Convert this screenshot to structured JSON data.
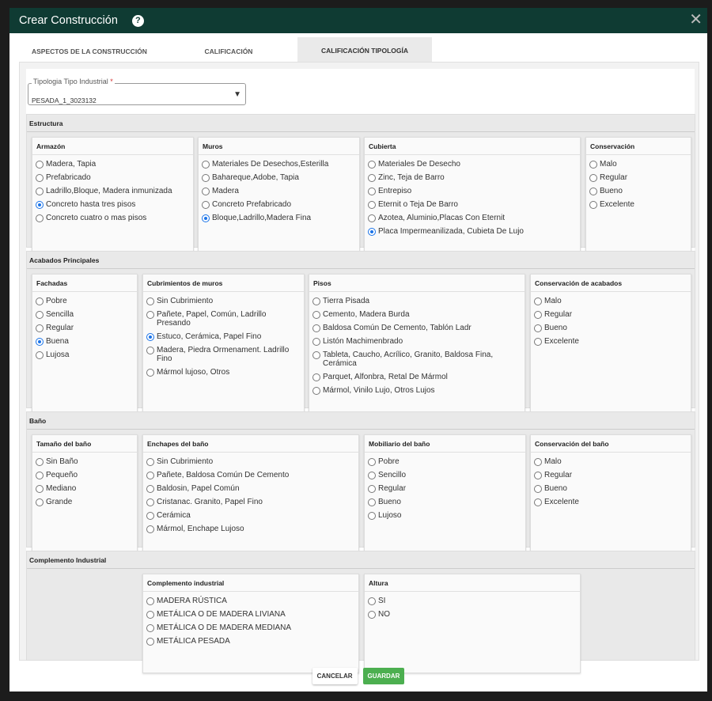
{
  "modal": {
    "title": "Crear Construcción",
    "close": "✕",
    "help": "?"
  },
  "tabs": [
    "ASPECTOS DE LA CONSTRUCCIÓN",
    "CALIFICACIÓN",
    "CALIFICACIÓN TIPOLOGÍA"
  ],
  "tipologia": {
    "label": "Tipologia Tipo Industrial",
    "required": "*",
    "value": "PESADA_1_3023132"
  },
  "sections": {
    "estructura": {
      "title": "Estructura",
      "groups": [
        {
          "title": "Armazón",
          "options": [
            "Madera, Tapia",
            "Prefabricado",
            "Ladrillo,Bloque, Madera inmunizada",
            "Concreto hasta tres pisos",
            "Concreto cuatro o mas pisos"
          ],
          "selected": 3
        },
        {
          "title": "Muros",
          "options": [
            "Materiales De Desechos,Esterilla",
            "Bahareque,Adobe, Tapia",
            "Madera",
            "Concreto Prefabricado",
            "Bloque,Ladrillo,Madera Fina"
          ],
          "selected": 4
        },
        {
          "title": "Cubierta",
          "options": [
            "Materiales De Desecho",
            "Zinc, Teja de Barro",
            "Entrepiso",
            "Eternit o Teja De Barro",
            "Azotea, Aluminio,Placas Con Eternit",
            "Placa Impermeanilizada, Cubieta De Lujo"
          ],
          "selected": 5
        },
        {
          "title": "Conservación",
          "options": [
            "Malo",
            "Regular",
            "Bueno",
            "Excelente"
          ],
          "selected": -1
        }
      ]
    },
    "acabados": {
      "title": "Acabados Principales",
      "groups": [
        {
          "title": "Fachadas",
          "options": [
            "Pobre",
            "Sencilla",
            "Regular",
            "Buena",
            "Lujosa"
          ],
          "selected": 3
        },
        {
          "title": "Cubrimientos de muros",
          "options": [
            "Sin Cubrimiento",
            "Pañete, Papel, Común, Ladrillo Presando",
            "Estuco, Cerámica, Papel Fino",
            "Madera, Piedra Ormenament. Ladrillo Fino",
            "Mármol lujoso, Otros"
          ],
          "selected": 2
        },
        {
          "title": "Pisos",
          "options": [
            "Tierra Pisada",
            "Cemento, Madera Burda",
            "Baldosa Común De Cemento, Tablón Ladr",
            "Listón Machimenbrado",
            "Tableta, Caucho, Acrílico, Granito, Baldosa Fina, Cerámica",
            "Parquet, Alfonbra, Retal De Mármol",
            "Mármol, Vinilo Lujo, Otros Lujos"
          ],
          "selected": -1
        },
        {
          "title": "Conservación de acabados",
          "options": [
            "Malo",
            "Regular",
            "Bueno",
            "Excelente"
          ],
          "selected": -1
        }
      ]
    },
    "bano": {
      "title": "Baño",
      "groups": [
        {
          "title": "Tamaño del baño",
          "options": [
            "Sin Baño",
            "Pequeño",
            "Mediano",
            "Grande"
          ],
          "selected": -1
        },
        {
          "title": "Enchapes del baño",
          "options": [
            "Sin Cubrimiento",
            "Pañete, Baldosa Común De Cemento",
            "Baldosin, Papel Común",
            "Cristanac. Granito, Papel Fino",
            "Cerámica",
            "Mármol, Enchape Lujoso"
          ],
          "selected": -1
        },
        {
          "title": "Mobiliario del baño",
          "options": [
            "Pobre",
            "Sencillo",
            "Regular",
            "Bueno",
            "Lujoso"
          ],
          "selected": -1
        },
        {
          "title": "Conservación del baño",
          "options": [
            "Malo",
            "Regular",
            "Bueno",
            "Excelente"
          ],
          "selected": -1
        }
      ]
    },
    "complemento": {
      "title": "Complemento Industrial",
      "groups": [
        {
          "title": "Complemento industrial",
          "options": [
            "MADERA RÚSTICA",
            "METÁLICA O DE MADERA LIVIANA",
            "METÁLICA O DE MADERA MEDIANA",
            "METÁLICA PESADA"
          ],
          "selected": -1
        },
        {
          "title": "Altura",
          "options": [
            "SI",
            "NO"
          ],
          "selected": -1
        }
      ]
    }
  },
  "footer": {
    "cancel": "CANCELAR",
    "save": "GUARDAR"
  }
}
